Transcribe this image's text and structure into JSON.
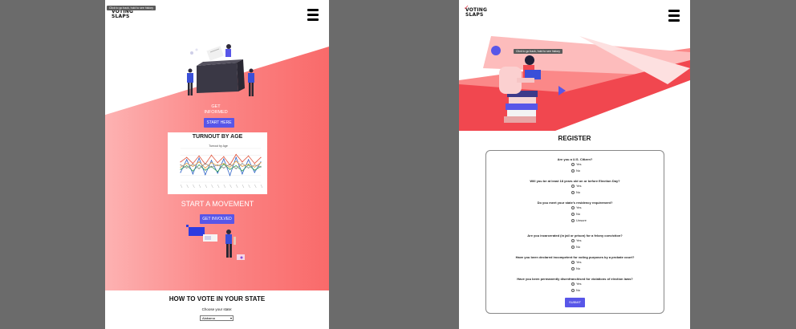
{
  "left_screen": {
    "tooltip": "Click to go back, hold to see history",
    "logo_line1": "VOTING",
    "logo_line2": "SLAPS",
    "get_informed": [
      "GET",
      "INFORMED"
    ],
    "start_here_button": "START HERE",
    "turnout_title": "TURNOUT BY AGE",
    "start_movement": "START A MOVEMENT",
    "get_involved_button": "GET INVOLVED",
    "how_to_vote_title": "HOW TO VOTE IN YOUR STATE",
    "choose_state_label": "Choose your state:",
    "state_select_value": "Alabama"
  },
  "right_screen": {
    "tooltip": "Click to go back, hold to see history",
    "logo_line1": "VOTING",
    "logo_line2": "SLAPS",
    "register_title": "REGISTER",
    "questions": [
      {
        "text": "Are you a U.S. Citizen?",
        "options": [
          "Yes",
          "No"
        ]
      },
      {
        "text": "Will you be at least 18 years old on or before Election Day?",
        "options": [
          "Yes",
          "No"
        ]
      },
      {
        "text": "Do you meet your state's residency requirement?",
        "options": [
          "Yes",
          "No",
          "Unsure"
        ]
      },
      {
        "text": "Are you incarcerated (in jail or prison) for a felony conviction?",
        "options": [
          "Yes",
          "No"
        ]
      },
      {
        "text": "Have you been declared incompetent for voting purposes by a probate court?",
        "options": [
          "Yes",
          "No"
        ]
      },
      {
        "text": "Have you been permanently disenfranchised for violations of election laws?",
        "options": [
          "Yes",
          "No"
        ]
      }
    ],
    "submit_button": "SUBMIT"
  },
  "colors": {
    "accent_button": "#5856e8",
    "gradient_light": "#fdb2b2",
    "gradient_dark": "#f96a6a",
    "brand_red": "#e6283a"
  },
  "chart_data": {
    "type": "line",
    "title": "Turnout by Age",
    "series": [
      {
        "color": "#e0533b",
        "values": [
          52,
          58,
          50,
          60,
          49,
          61,
          51,
          59,
          48,
          62,
          52,
          60,
          50,
          58
        ]
      },
      {
        "color": "#2f64c8",
        "values": [
          38,
          55,
          36,
          57,
          35,
          54,
          37,
          56,
          34,
          58,
          36,
          55,
          38,
          52
        ]
      },
      {
        "color": "#e8a23c",
        "values": [
          45,
          50,
          46,
          52,
          44,
          51,
          47,
          50,
          45,
          53,
          46,
          49,
          45,
          51
        ]
      },
      {
        "color": "#3aa354",
        "values": [
          42,
          47,
          40,
          48,
          41,
          46,
          39,
          49,
          42,
          47,
          40,
          48,
          41,
          46
        ]
      },
      {
        "color": "#8c8c8c",
        "values": [
          48,
          44,
          49,
          43,
          50,
          45,
          48,
          44,
          49,
          43,
          50,
          44,
          48,
          45
        ]
      }
    ],
    "ylim": [
      25,
      70
    ]
  }
}
